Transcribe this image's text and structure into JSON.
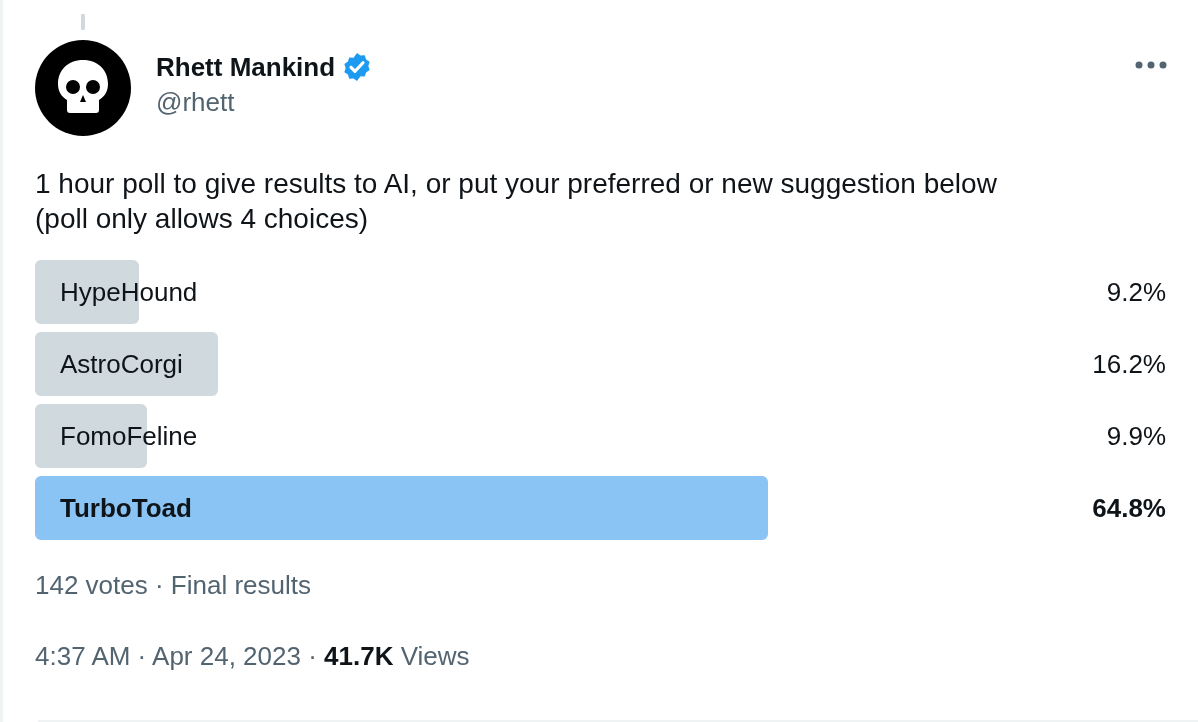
{
  "author": {
    "name": "Rhett Mankind",
    "handle": "@rhett",
    "verified": true
  },
  "body": "1 hour poll to give results to AI, or put your preferred or new suggestion below (poll only allows 4 choices)",
  "poll": {
    "options": [
      {
        "label": "HypeHound",
        "percent": "9.2%",
        "selected": false
      },
      {
        "label": "AstroCorgi",
        "percent": "16.2%",
        "selected": false
      },
      {
        "label": "FomoFeline",
        "percent": "9.9%",
        "selected": false
      },
      {
        "label": "TurboToad",
        "percent": "64.8%",
        "selected": true
      }
    ],
    "summary": "142 votes · Final results"
  },
  "timestamp": "4:37 AM · Apr 24, 2023 · **41.7K** Views"
}
